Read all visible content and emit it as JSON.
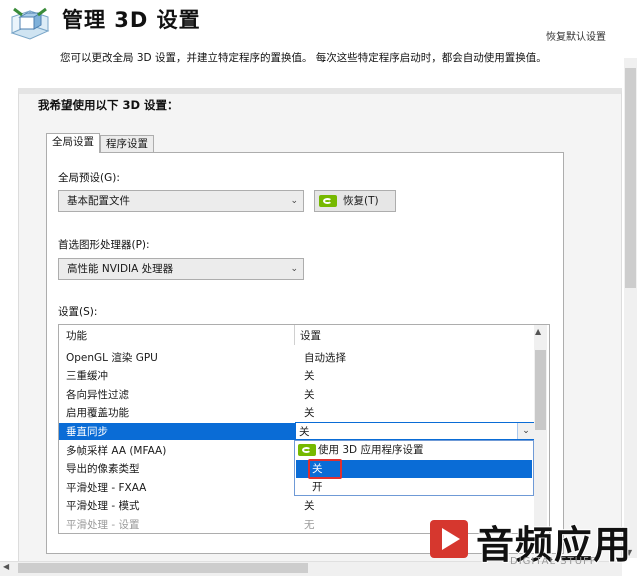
{
  "header": {
    "title": "管理 3D 设置",
    "restore_defaults": "恢复默认设置",
    "description": "您可以更改全局 3D 设置，并建立特定程序的置换值。 每次这些特定程序启动时，都会自动使用置换值。"
  },
  "panel": {
    "heading": "我希望使用以下 3D 设置：",
    "tabs": [
      {
        "label": "全局设置",
        "selected": true
      },
      {
        "label": "程序设置",
        "selected": false
      }
    ],
    "global_preset": {
      "label": "全局预设(G):",
      "value": "基本配置文件",
      "restore_button": "恢复(T)"
    },
    "preferred_gpu": {
      "label": "首选图形处理器(P):",
      "value": "高性能 NVIDIA 处理器"
    },
    "settings": {
      "label": "设置(S):",
      "columns": [
        "功能",
        "设置"
      ],
      "rows": [
        {
          "feature": "OpenGL 渲染 GPU",
          "value": "自动选择",
          "state": "normal"
        },
        {
          "feature": "三重缓冲",
          "value": "关",
          "state": "normal"
        },
        {
          "feature": "各向异性过滤",
          "value": "关",
          "state": "normal"
        },
        {
          "feature": "启用覆盖功能",
          "value": "关",
          "state": "normal"
        },
        {
          "feature": "垂直同步",
          "value": "关",
          "state": "selected"
        },
        {
          "feature": "多帧采样 AA (MFAA)",
          "value": "",
          "state": "normal"
        },
        {
          "feature": "导出的像素类型",
          "value": "",
          "state": "normal"
        },
        {
          "feature": "平滑处理 - FXAA",
          "value": "",
          "state": "normal"
        },
        {
          "feature": "平滑处理 - 模式",
          "value": "关",
          "state": "normal"
        },
        {
          "feature": "平滑处理 - 设置",
          "value": "无",
          "state": "disabled"
        }
      ],
      "dropdown_options": [
        {
          "label": "使用 3D 应用程序设置",
          "icon": "nvidia-icon"
        },
        {
          "label": "关",
          "highlighted": true
        },
        {
          "label": "开"
        }
      ]
    }
  },
  "watermark": {
    "text": "音频应用",
    "sub": "DIGITAL STUFF"
  },
  "colors": {
    "accent": "#0a6cd6",
    "nvidia_green": "#76b900",
    "highlight_box": "#e03030"
  }
}
